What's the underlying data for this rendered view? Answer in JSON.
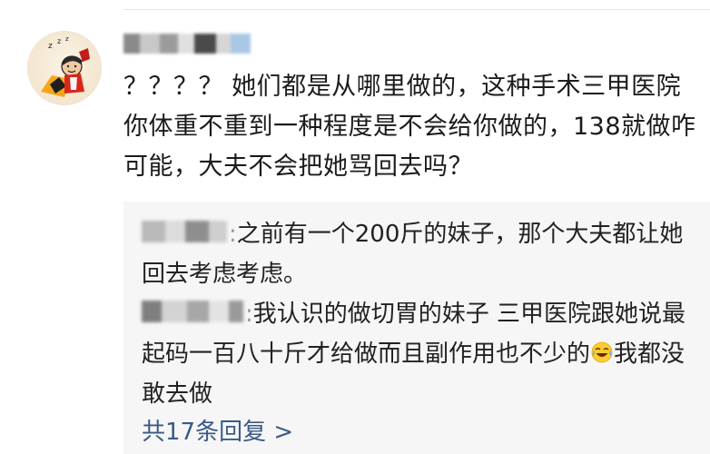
{
  "comment": {
    "text": "？？？？ 她们都是从哪里做的，这种手术三甲医院你体重不重到一种程度是不会给你做的，138就做咋可能，大夫不会把她骂回去吗？"
  },
  "replies": [
    {
      "text": "之前有一个200斤的妹子，那个大夫都让她回去考虑考虑。"
    },
    {
      "text_before_emoji": "我认识的做切胃的妹子 三甲医院跟她说最起码一百八十斤才给做而且副作用也不少的",
      "emoji": "laughing-crying-emoji",
      "text_after_emoji": "我都没敢去做"
    }
  ],
  "more_replies_label": "共17条回复 >",
  "colors": {
    "link": "#3b5a86",
    "reply_bg": "#f6f6f6",
    "text": "#1b1b1b"
  }
}
